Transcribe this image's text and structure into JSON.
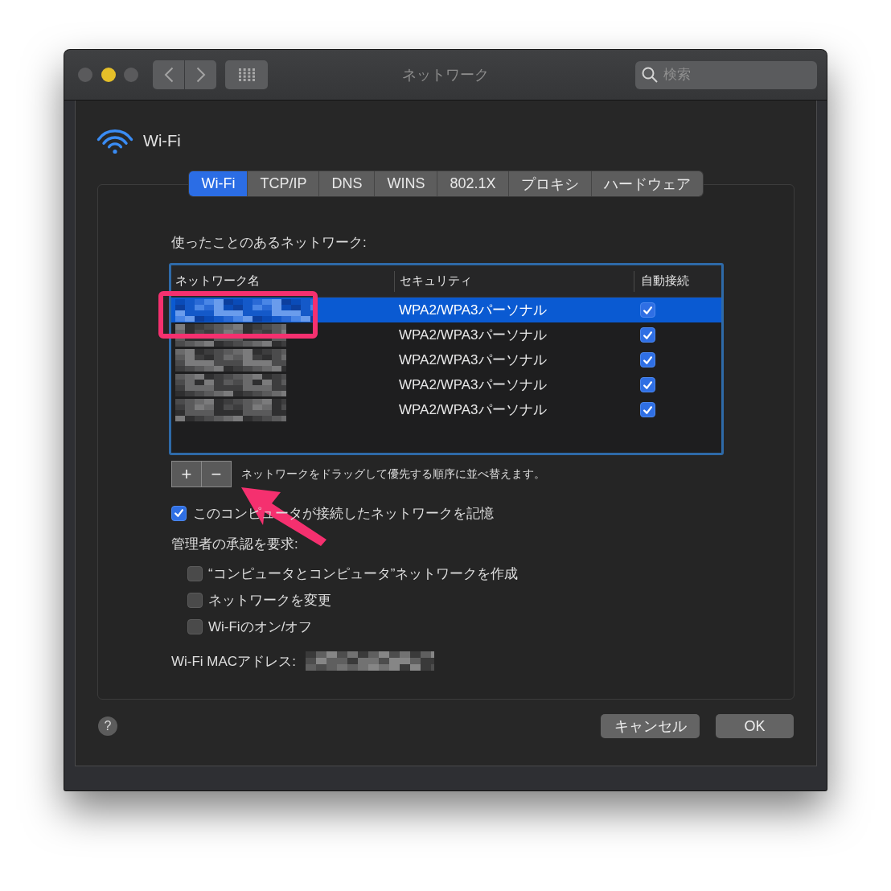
{
  "window": {
    "title": "ネットワーク",
    "search": {
      "placeholder": "検索"
    }
  },
  "traffic_lights": [
    {
      "color": "#5a5a5c"
    },
    {
      "color": "#e5bf29"
    },
    {
      "color": "#5a5a5c"
    }
  ],
  "interface": {
    "name": "Wi-Fi"
  },
  "tabs": [
    {
      "label": "Wi-Fi",
      "selected": true
    },
    {
      "label": "TCP/IP",
      "selected": false
    },
    {
      "label": "DNS",
      "selected": false
    },
    {
      "label": "WINS",
      "selected": false
    },
    {
      "label": "802.1X",
      "selected": false
    },
    {
      "label": "プロキシ",
      "selected": false
    },
    {
      "label": "ハードウェア",
      "selected": false
    }
  ],
  "preferred_networks": {
    "label": "使ったことのあるネットワーク:",
    "columns": [
      "ネットワーク名",
      "セキュリティ",
      "自動接続"
    ],
    "rows": [
      {
        "selected": true,
        "security": "WPA2/WPA3パーソナル",
        "auto_join": true
      },
      {
        "selected": false,
        "security": "WPA2/WPA3パーソナル",
        "auto_join": true
      },
      {
        "selected": false,
        "security": "WPA2/WPA3パーソナル",
        "auto_join": true
      },
      {
        "selected": false,
        "security": "WPA2/WPA3パーソナル",
        "auto_join": true
      },
      {
        "selected": false,
        "security": "WPA2/WPA3パーソナル",
        "auto_join": true
      }
    ]
  },
  "list_controls": {
    "add": "+",
    "remove": "−",
    "hint": "ネットワークをドラッグして優先する順序に並べ替えます。"
  },
  "remember_networks": {
    "label": "このコンピュータが接続したネットワークを記憶",
    "checked": true
  },
  "admin_approval": {
    "label": "管理者の承認を要求:",
    "options": [
      {
        "label": "“コンピュータとコンピュータ”ネットワークを作成",
        "checked": false
      },
      {
        "label": "ネットワークを変更",
        "checked": false
      },
      {
        "label": "Wi-Fiのオン/オフ",
        "checked": false
      }
    ]
  },
  "mac_address": {
    "label": "Wi-Fi MACアドレス:"
  },
  "help_button": "?",
  "buttons": [
    {
      "label": "キャンセル"
    },
    {
      "label": "OK"
    }
  ]
}
